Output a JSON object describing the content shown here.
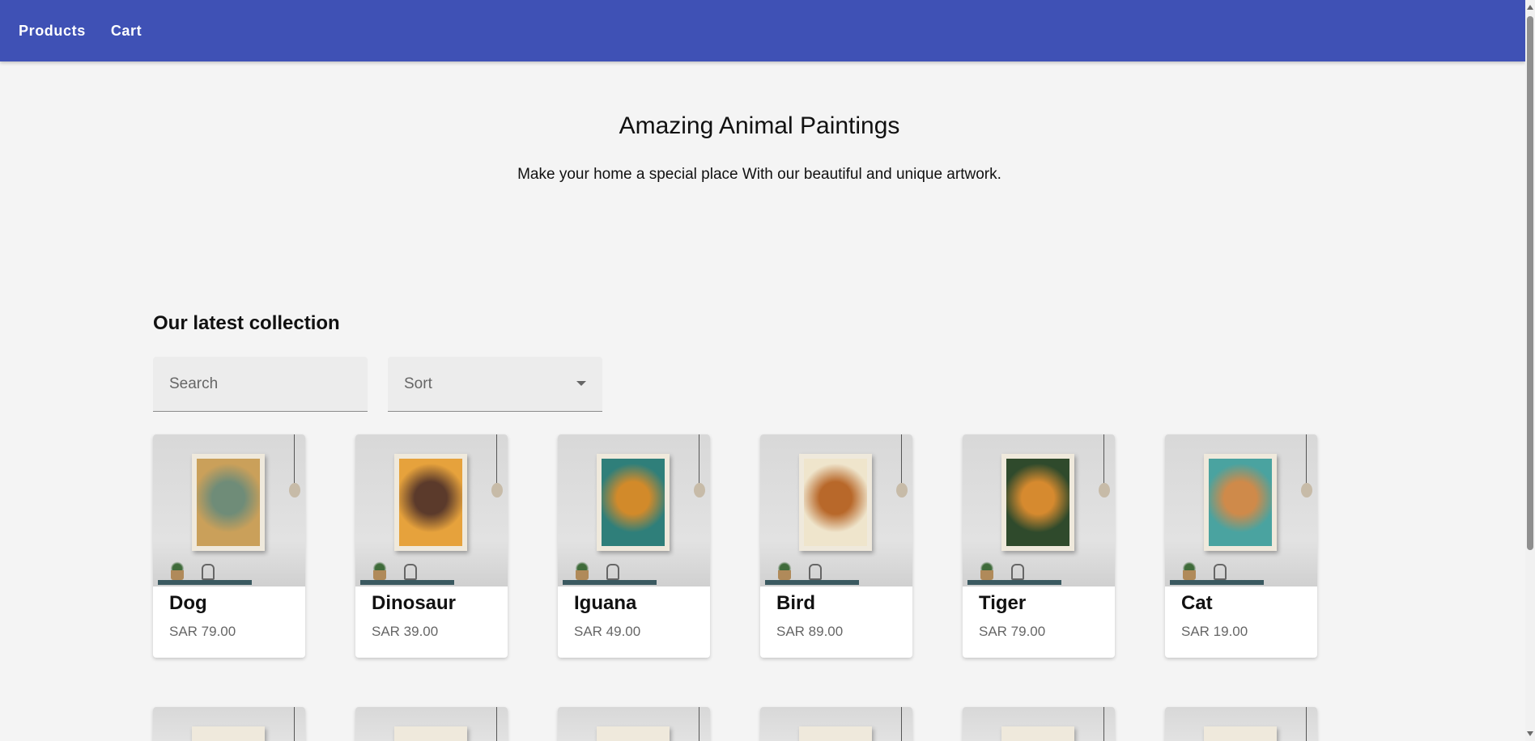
{
  "nav": {
    "items": [
      {
        "label": "Products"
      },
      {
        "label": "Cart"
      }
    ]
  },
  "hero": {
    "title": "Amazing Animal Paintings",
    "subtitle": "Make your home a special place With our beautiful and unique artwork."
  },
  "section": {
    "title": "Our latest collection"
  },
  "controls": {
    "search_placeholder": "Search",
    "sort_label": "Sort"
  },
  "products": [
    {
      "name": "Dog",
      "price": "SAR 79.00",
      "art_color_a": "#caa05a",
      "art_color_b": "#6f8c78"
    },
    {
      "name": "Dinosaur",
      "price": "SAR 39.00",
      "art_color_a": "#e6a23c",
      "art_color_b": "#5b3a2b"
    },
    {
      "name": "Iguana",
      "price": "SAR 49.00",
      "art_color_a": "#2f7f7a",
      "art_color_b": "#d28a2a"
    },
    {
      "name": "Bird",
      "price": "SAR 89.00",
      "art_color_a": "#efe5cc",
      "art_color_b": "#b8682a"
    },
    {
      "name": "Tiger",
      "price": "SAR 79.00",
      "art_color_a": "#2f4a2c",
      "art_color_b": "#d68a2f"
    },
    {
      "name": "Cat",
      "price": "SAR 19.00",
      "art_color_a": "#4aa3a0",
      "art_color_b": "#cf8a4a"
    }
  ],
  "colors": {
    "app_bar": "#3f51b5",
    "background": "#f4f4f4"
  }
}
